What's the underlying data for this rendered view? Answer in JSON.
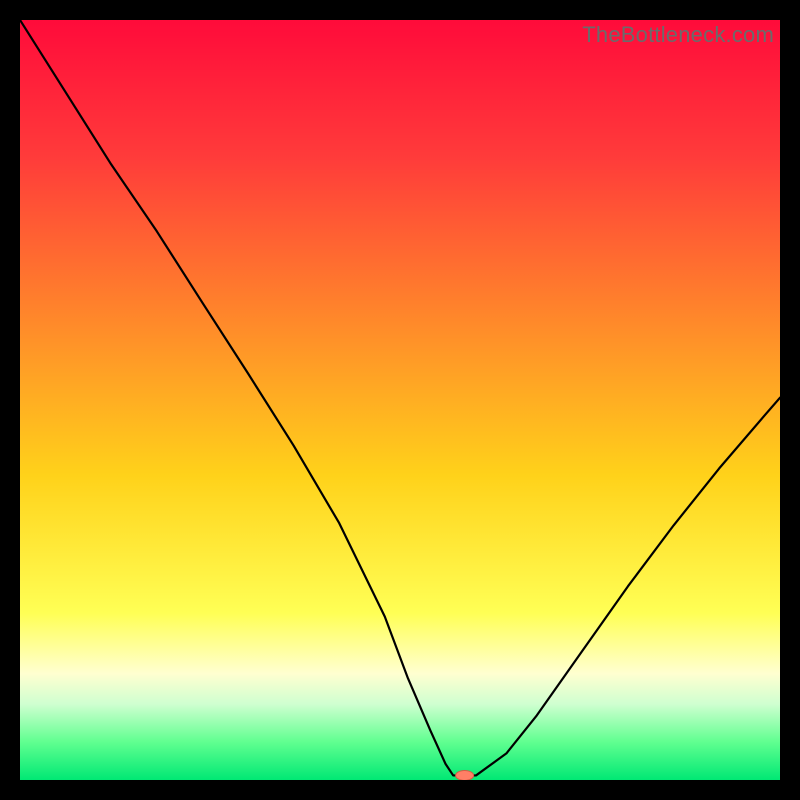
{
  "watermark": "TheBottleneck.com",
  "chart_data": {
    "type": "line",
    "title": "",
    "xlabel": "",
    "ylabel": "",
    "xlim": [
      0,
      100
    ],
    "ylim": [
      0,
      100
    ],
    "background_gradient": {
      "stops": [
        {
          "offset": 0,
          "color": "#ff0b3a"
        },
        {
          "offset": 18,
          "color": "#ff3b3a"
        },
        {
          "offset": 40,
          "color": "#ff8a2a"
        },
        {
          "offset": 60,
          "color": "#ffd21a"
        },
        {
          "offset": 78,
          "color": "#ffff55"
        },
        {
          "offset": 86,
          "color": "#ffffd0"
        },
        {
          "offset": 90,
          "color": "#cfffd0"
        },
        {
          "offset": 95,
          "color": "#60ff90"
        },
        {
          "offset": 100,
          "color": "#00e874"
        }
      ]
    },
    "series": [
      {
        "name": "bottleneck-curve",
        "stroke": "#000000",
        "stroke_width": 2.2,
        "x": [
          0,
          6,
          12,
          18,
          24,
          30,
          36,
          42,
          48,
          51,
          54,
          56,
          57,
          60,
          64,
          68,
          74,
          80,
          86,
          92,
          98,
          100
        ],
        "values": [
          100,
          90.5,
          81,
          72.2,
          62.8,
          53.5,
          44,
          33.8,
          21.5,
          13.5,
          6.5,
          2.1,
          0.6,
          0.6,
          3.5,
          8.5,
          17,
          25.5,
          33.5,
          41,
          48,
          50.3
        ]
      }
    ],
    "marker": {
      "name": "optimal-point",
      "x": 58.5,
      "y": 0.6,
      "shape": "pill",
      "fill": "#ff7f66",
      "stroke": "#d55b44",
      "rx": 9,
      "ry": 5
    }
  }
}
